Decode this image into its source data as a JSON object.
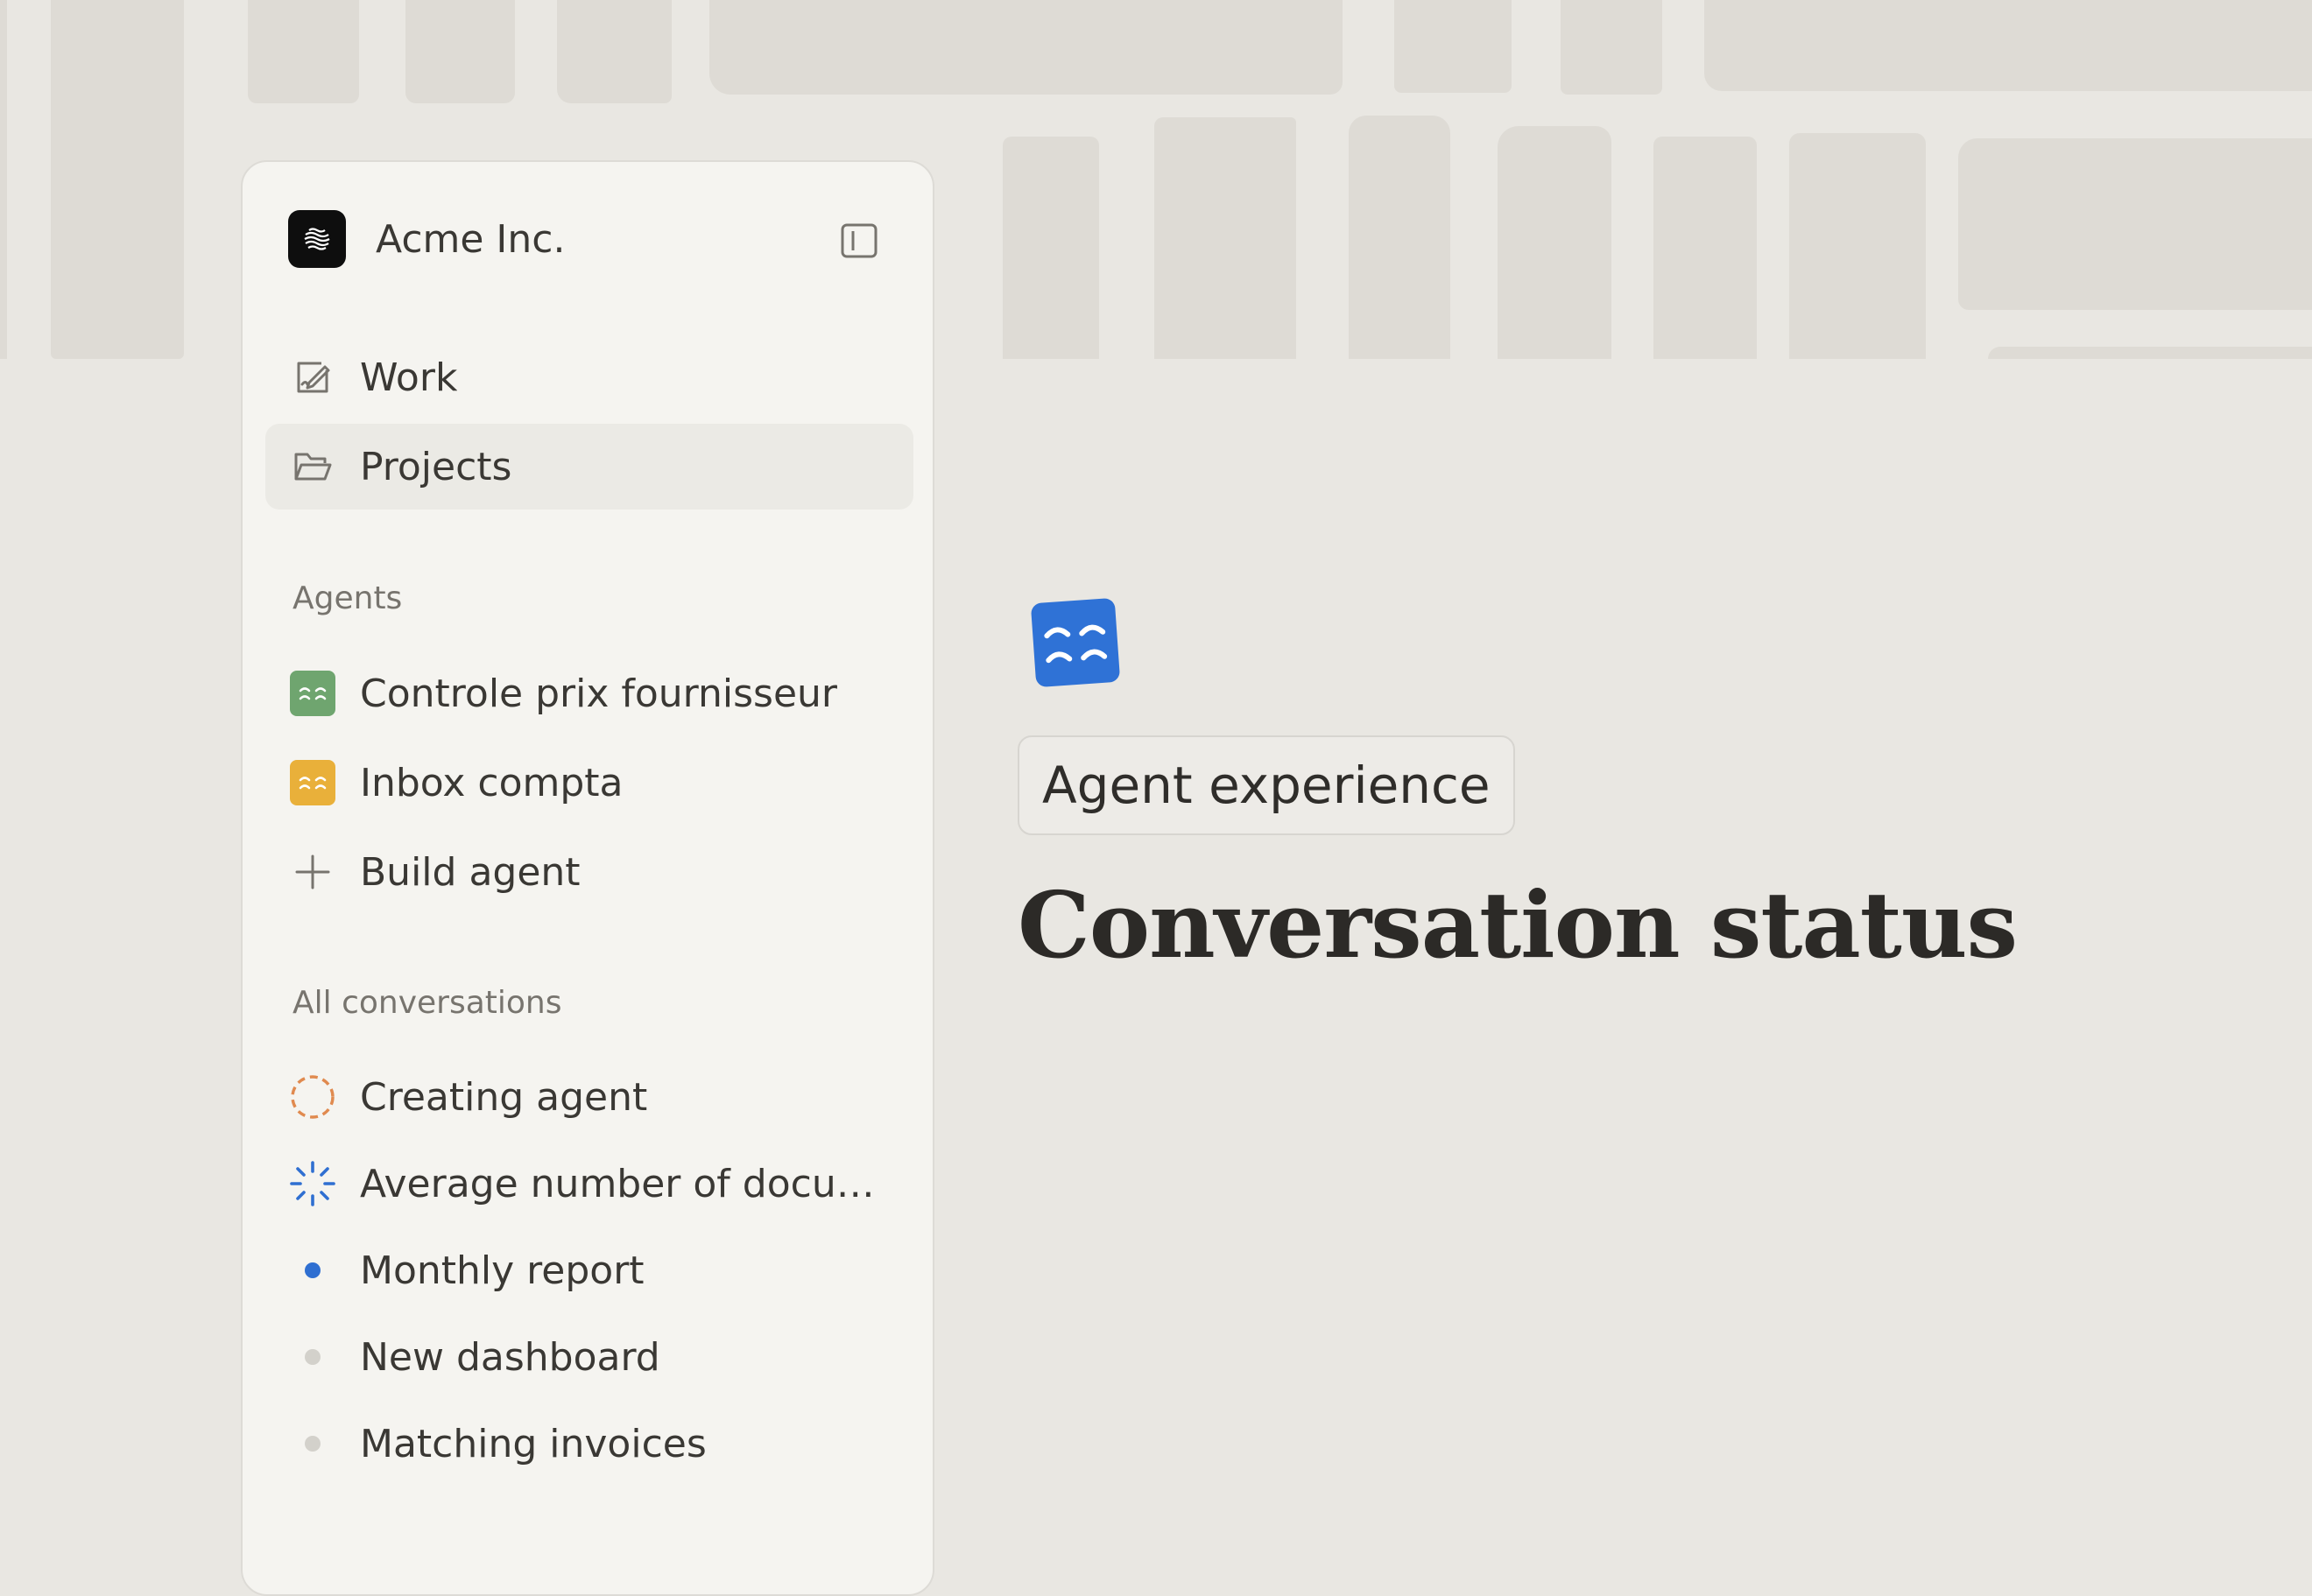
{
  "workspace": {
    "name": "Acme Inc."
  },
  "nav": [
    {
      "label": "Work",
      "icon": "edit-icon"
    },
    {
      "label": "Projects",
      "icon": "folder-icon",
      "active": true
    }
  ],
  "agents_section": {
    "title": "Agents",
    "items": [
      {
        "label": "Controle prix fournisseur",
        "color": "#6FA56F"
      },
      {
        "label": "Inbox compta",
        "color": "#E9B03A"
      }
    ],
    "build_label": "Build agent"
  },
  "conversations_section": {
    "title": "All conversations",
    "items": [
      {
        "label": "Creating agent",
        "status": "creating",
        "color": "#E08A4F"
      },
      {
        "label": "Average number of docume...",
        "status": "loading",
        "color": "#2F6FD1"
      },
      {
        "label": "Monthly report",
        "status": "unread",
        "color": "#2F6FD1"
      },
      {
        "label": "New dashboard",
        "status": "idle",
        "color": "#D3D1CB"
      },
      {
        "label": "Matching invoices",
        "status": "idle",
        "color": "#D3D1CB"
      }
    ]
  },
  "main": {
    "tag": "Agent experience",
    "title": "Conversation status",
    "agent_color": "#2F72D6"
  }
}
